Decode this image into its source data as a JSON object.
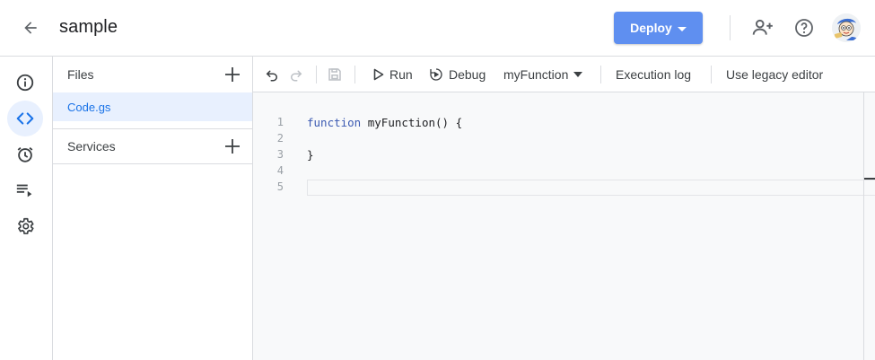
{
  "header": {
    "project_title": "sample",
    "deploy_label": "Deploy"
  },
  "files_panel": {
    "files_label": "Files",
    "files": [
      {
        "name": "Code.gs"
      }
    ],
    "services_label": "Services"
  },
  "toolbar": {
    "run_label": "Run",
    "debug_label": "Debug",
    "function_select_value": "myFunction",
    "execution_log_label": "Execution log",
    "legacy_editor_label": "Use legacy editor"
  },
  "editor": {
    "line_numbers": [
      "1",
      "2",
      "3",
      "4",
      "5"
    ],
    "keyword": "function",
    "line1_rest": " myFunction() {",
    "line3": "}"
  },
  "icons": {
    "back": "arrow-back-icon",
    "add_person": "person-add-icon",
    "help": "help-icon",
    "overview": "info-icon",
    "editor": "code-icon",
    "triggers": "alarm-icon",
    "executions": "playlist-play-icon",
    "settings": "gear-icon"
  },
  "colors": {
    "accent": "#1a73e8",
    "deploy_button": "#5f8ff0",
    "selected_bg": "#e8f0fe"
  }
}
